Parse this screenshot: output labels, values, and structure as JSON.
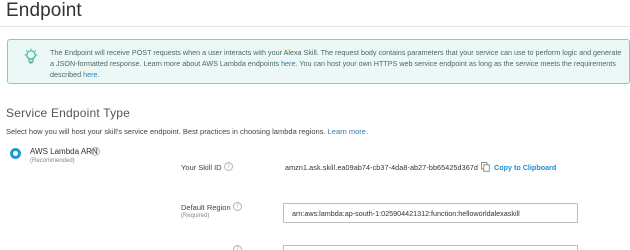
{
  "page": {
    "title": "Endpoint"
  },
  "info_banner": {
    "text_1": "The Endpoint will receive POST requests when a user interacts with your Alexa Skill. The request body contains parameters that your service can use to perform logic and generate a JSON-formatted response. Learn more about AWS Lambda endpoints ",
    "link_1": "here",
    "text_2": ". You can host your own HTTPS web service endpoint as long as the service meets the requirements described ",
    "link_2": "here",
    "text_3": "."
  },
  "service_endpoint": {
    "title": "Service Endpoint Type",
    "description": "Select how you will host your skill's service endpoint. Best practices in choosing lambda regions.",
    "learn_more": "Learn more.",
    "option_label": "AWS Lambda ARN",
    "option_sub": "(Recommended)"
  },
  "skill_id": {
    "label": "Your Skill ID",
    "value": "amzn1.ask.skill.ea09ab74-cb37-4da8-ab27-bb65425d367d",
    "copy_label": "Copy to Clipboard"
  },
  "default_region": {
    "label": "Default Region",
    "sub": "(Required)",
    "value": "arn:aws:lambda:ap-south-1:025904421312:function:helloworldalexaskill"
  },
  "icons": {
    "help": "?",
    "bulb_color": "#2fb39a",
    "accent_color": "#1f9bd6"
  }
}
